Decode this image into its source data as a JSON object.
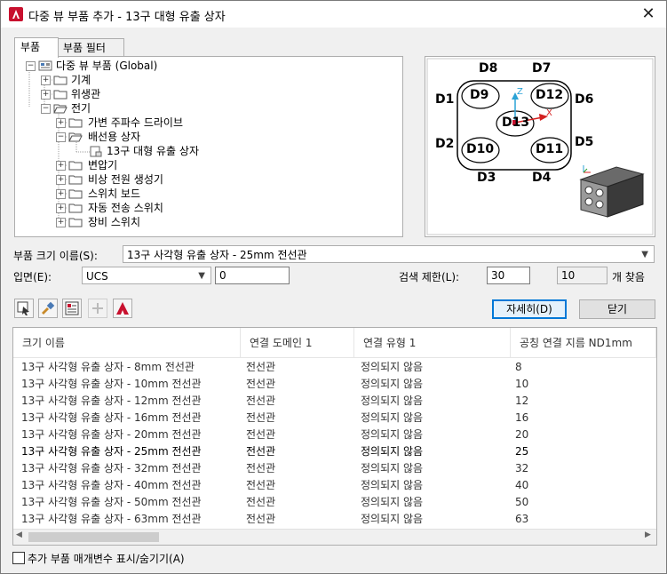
{
  "title": "다중 뷰 부품 추가 - 13구 대형 유출 상자",
  "close_glyph": "✕",
  "tabs": [
    {
      "label": "부품"
    },
    {
      "label": "부품 필터"
    }
  ],
  "tree": [
    {
      "label": "다중 뷰 부품 (Global)",
      "expander": "−"
    },
    {
      "label": "기계",
      "expander": "+"
    },
    {
      "label": "위생관",
      "expander": "+"
    },
    {
      "label": "전기",
      "expander": "−"
    },
    {
      "label": "가변 주파수 드라이브",
      "expander": "+"
    },
    {
      "label": "배선용 상자",
      "expander": "−"
    },
    {
      "label": "13구 대형 유출 상자"
    },
    {
      "label": "변압기",
      "expander": "+"
    },
    {
      "label": "비상 전원 생성기",
      "expander": "+"
    },
    {
      "label": "스위치 보드",
      "expander": "+"
    },
    {
      "label": "자동 전송 스위치",
      "expander": "+"
    },
    {
      "label": "장비 스위치",
      "expander": "+"
    }
  ],
  "preview": {
    "ports": [
      "D9",
      "D12",
      "D13",
      "D10",
      "D11"
    ],
    "outer_labels": [
      "D8",
      "D7",
      "D1",
      "D6",
      "D2",
      "D5",
      "D3",
      "D4"
    ],
    "axis_z": "Z",
    "axis_x": "X",
    "colors": {
      "axis_x": "#d42020",
      "axis_z": "#2ba3d6"
    }
  },
  "part_size": {
    "label": "부품 크기 이름(S):",
    "value": "13구 사각형 유출 상자 - 25mm 전선관"
  },
  "elevation": {
    "label": "입면(E):",
    "value": "UCS",
    "offset_value": "0"
  },
  "search": {
    "label": "검색 제한(L):",
    "limit": "30",
    "found_count": "10",
    "found_suffix": "개 찾음"
  },
  "buttons": {
    "details": "자세히(D)",
    "close": "닫기"
  },
  "grid": {
    "headers": [
      "크기 이름",
      "연결 도메인 1",
      "연결 유형 1",
      "공칭 연결 지름 ND1mm"
    ],
    "rows": [
      [
        "13구 사각형 유출 상자 - 8mm 전선관",
        "전선관",
        "정의되지 않음",
        "8"
      ],
      [
        "13구 사각형 유출 상자 - 10mm 전선관",
        "전선관",
        "정의되지 않음",
        "10"
      ],
      [
        "13구 사각형 유출 상자 - 12mm 전선관",
        "전선관",
        "정의되지 않음",
        "12"
      ],
      [
        "13구 사각형 유출 상자 - 16mm 전선관",
        "전선관",
        "정의되지 않음",
        "16"
      ],
      [
        "13구 사각형 유출 상자 - 20mm 전선관",
        "전선관",
        "정의되지 않음",
        "20"
      ],
      [
        "13구 사각형 유출 상자 - 25mm 전선관",
        "전선관",
        "정의되지 않음",
        "25"
      ],
      [
        "13구 사각형 유출 상자 - 32mm 전선관",
        "전선관",
        "정의되지 않음",
        "32"
      ],
      [
        "13구 사각형 유출 상자 - 40mm 전선관",
        "전선관",
        "정의되지 않음",
        "40"
      ],
      [
        "13구 사각형 유출 상자 - 50mm 전선관",
        "전선관",
        "정의되지 않음",
        "50"
      ],
      [
        "13구 사각형 유출 상자 - 63mm 전선관",
        "전선관",
        "정의되지 않음",
        "63"
      ]
    ],
    "selected_index": 5,
    "scroll_left_glyph": "◀",
    "scroll_right_glyph": "▶"
  },
  "footer": {
    "checkbox_label": "추가 부품 매개변수 표시/숨기기(A)",
    "checked": false
  },
  "colors": {
    "accent": "#0078d7",
    "app_icon": "#c8102e"
  }
}
